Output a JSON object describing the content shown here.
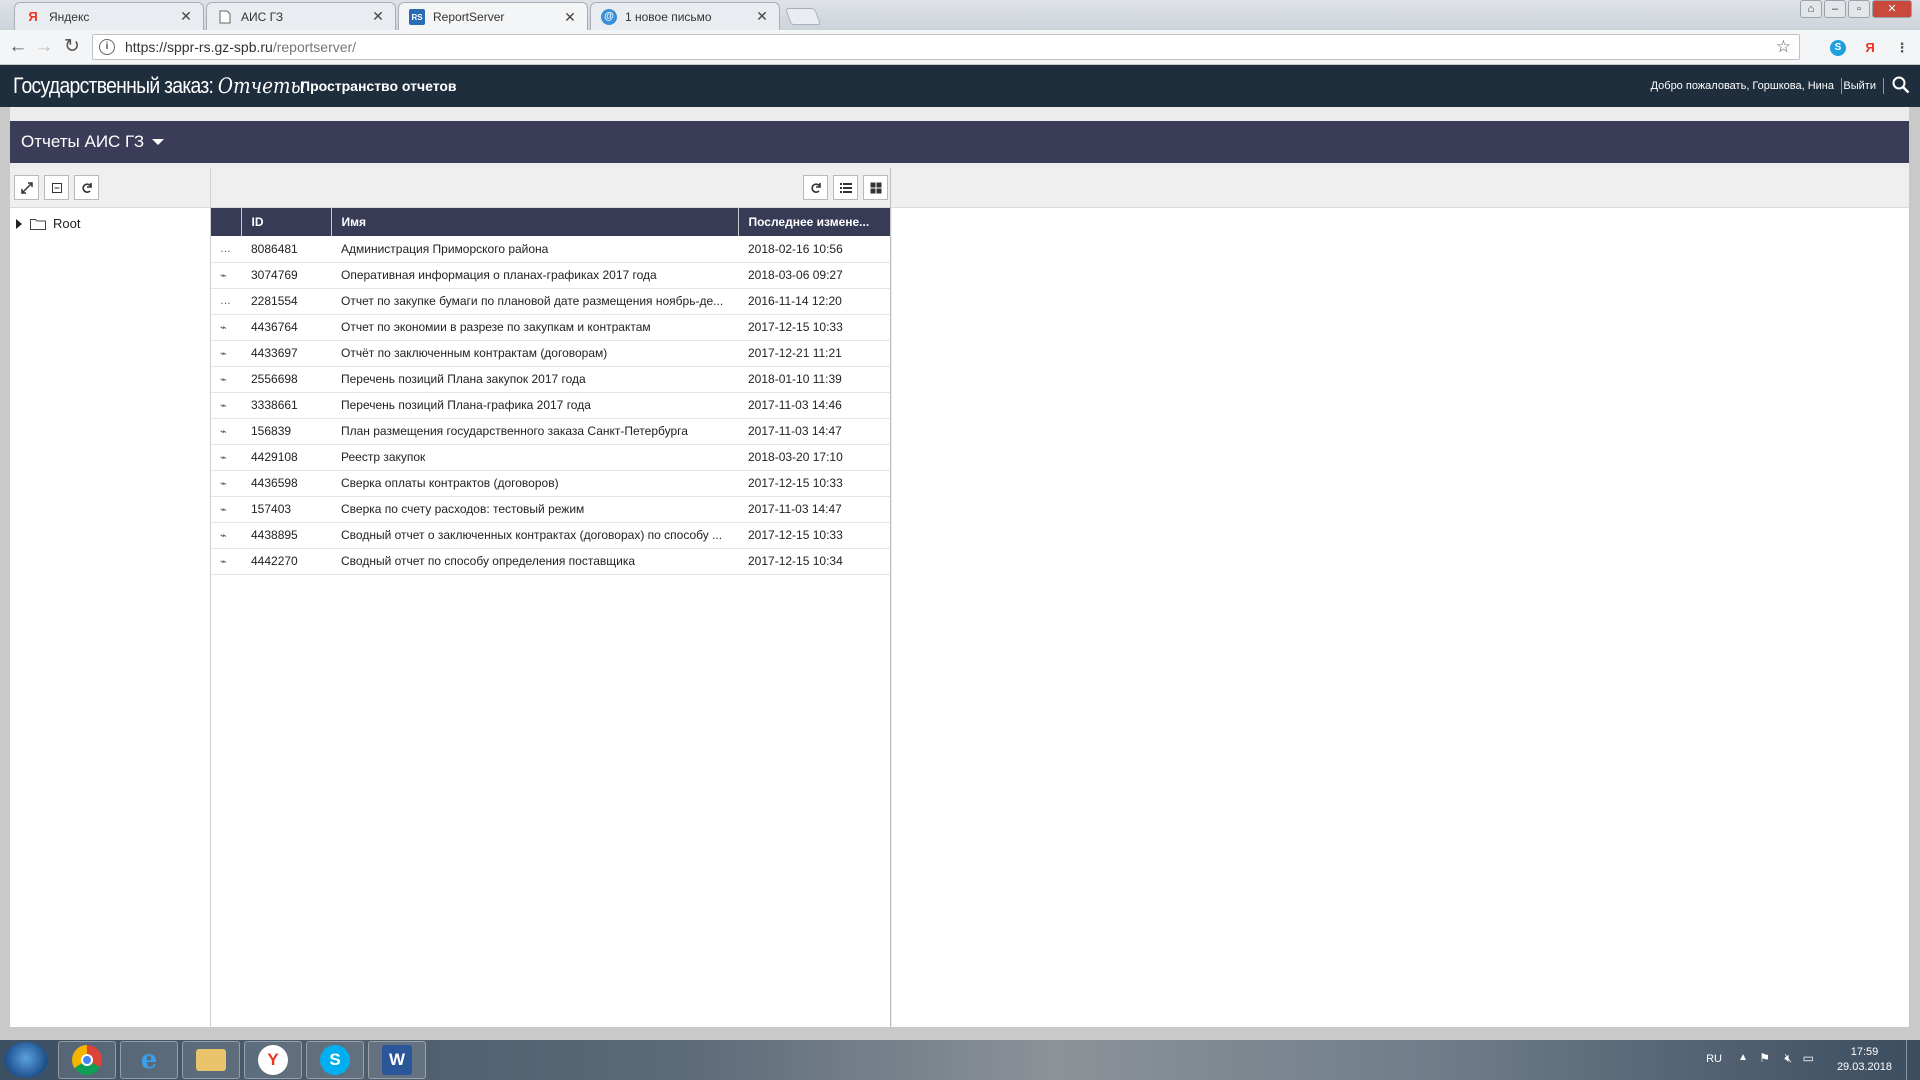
{
  "browser": {
    "tabs": [
      {
        "title": "Яндекс",
        "icon": "yandex-icon"
      },
      {
        "title": "АИС ГЗ",
        "icon": "page-icon"
      },
      {
        "title": "ReportServer",
        "icon": "reportserver-icon"
      },
      {
        "title": "1 новое письмо",
        "icon": "mail-icon"
      }
    ],
    "active_tab": 2,
    "url_host": "https://sppr-rs.gz-spb.ru",
    "url_path": "/reportserver/"
  },
  "header": {
    "brand": "Государственный заказ:",
    "brand_script": "Отчеты",
    "space_link": "Пространство отчетов",
    "welcome": "Добро пожаловать, Горшкова, Нина",
    "logout": "Выйти"
  },
  "folder": {
    "title": "Отчеты АИС ГЗ"
  },
  "tree": {
    "root": "Root"
  },
  "table": {
    "columns": [
      "ID",
      "Имя",
      "Последнее измене..."
    ],
    "rows": [
      {
        "icon": "…",
        "id": "8086481",
        "name": "Администрация Приморского района",
        "modified": "2018-02-16 10:56"
      },
      {
        "icon": "⌁",
        "id": "3074769",
        "name": "Оперативная информация о планах-графиках 2017 года",
        "modified": "2018-03-06 09:27"
      },
      {
        "icon": "…",
        "id": "2281554",
        "name": "Отчет по закупке бумаги по плановой дате размещения ноябрь-де...",
        "modified": "2016-11-14 12:20"
      },
      {
        "icon": "⌁",
        "id": "4436764",
        "name": "Отчет по экономии в разрезе по закупкам и контрактам",
        "modified": "2017-12-15 10:33"
      },
      {
        "icon": "⌁",
        "id": "4433697",
        "name": "Отчёт по заключенным контрактам (договорам)",
        "modified": "2017-12-21 11:21"
      },
      {
        "icon": "⌁",
        "id": "2556698",
        "name": "Перечень позиций Плана закупок 2017 года",
        "modified": "2018-01-10 11:39"
      },
      {
        "icon": "⌁",
        "id": "3338661",
        "name": "Перечень позиций Плана-графика 2017 года",
        "modified": "2017-11-03 14:46"
      },
      {
        "icon": "⌁",
        "id": "156839",
        "name": "План размещения государственного заказа Санкт-Петербурга",
        "modified": "2017-11-03 14:47"
      },
      {
        "icon": "⌁",
        "id": "4429108",
        "name": "Реестр закупок",
        "modified": "2018-03-20 17:10"
      },
      {
        "icon": "⌁",
        "id": "4436598",
        "name": "Сверка оплаты контрактов (договоров)",
        "modified": "2017-12-15 10:33"
      },
      {
        "icon": "⌁",
        "id": "157403",
        "name": "Сверка по счету расходов: тестовый режим",
        "modified": "2017-11-03 14:47"
      },
      {
        "icon": "⌁",
        "id": "4438895",
        "name": "Сводный отчет о заключенных контрактах (договорах) по способу ...",
        "modified": "2017-12-15 10:33"
      },
      {
        "icon": "⌁",
        "id": "4442270",
        "name": "Сводный отчет по способу определения поставщика",
        "modified": "2017-12-15 10:34"
      }
    ]
  },
  "taskbar": {
    "lang": "RU",
    "time": "17:59",
    "date": "29.03.2018"
  },
  "colors": {
    "header_bg": "#1f2e3d",
    "folderbar_bg": "#3b3d58",
    "grid_header_bg": "#383b55"
  }
}
